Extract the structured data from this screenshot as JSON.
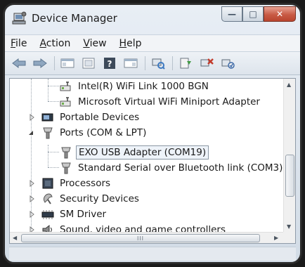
{
  "window": {
    "title": "Device Manager",
    "buttons": {
      "minimize": "—",
      "maximize": "□",
      "close": "✕"
    }
  },
  "menu": [
    {
      "underline": "F",
      "rest": "ile"
    },
    {
      "underline": "A",
      "rest": "ction"
    },
    {
      "underline": "V",
      "rest": "iew"
    },
    {
      "underline": "H",
      "rest": "elp"
    }
  ],
  "toolbar": {
    "icons": [
      "back-icon",
      "forward-icon",
      "console-tree-icon",
      "properties-icon",
      "help-icon",
      "action-pane-icon",
      "scan-hardware-icon",
      "update-driver-icon",
      "uninstall-icon",
      "disable-icon"
    ]
  },
  "tree": {
    "items": [
      {
        "label": "Intel(R) WiFi Link 1000 BGN",
        "level": 2,
        "icon": "network-adapter-icon"
      },
      {
        "label": "Microsoft Virtual WiFi Miniport Adapter",
        "level": 2,
        "icon": "network-adapter-icon"
      },
      {
        "label": "Portable Devices",
        "level": 1,
        "icon": "portable-device-icon",
        "expander": "collapsed"
      },
      {
        "label": "Ports (COM & LPT)",
        "level": 1,
        "icon": "port-icon",
        "expander": "expanded"
      },
      {
        "label": "EXO USB Adapter (COM19)",
        "level": 2,
        "icon": "port-icon",
        "selected": true
      },
      {
        "label": "Standard Serial over Bluetooth link (COM3)",
        "level": 2,
        "icon": "port-icon"
      },
      {
        "label": "Processors",
        "level": 1,
        "icon": "processor-icon",
        "expander": "collapsed"
      },
      {
        "label": "Security Devices",
        "level": 1,
        "icon": "security-device-icon",
        "expander": "collapsed"
      },
      {
        "label": "SM Driver",
        "level": 1,
        "icon": "sm-driver-icon",
        "expander": "collapsed"
      },
      {
        "label": "Sound, video and game controllers",
        "level": 1,
        "icon": "sound-icon",
        "expander": "collapsed"
      }
    ]
  },
  "scrollbar": {
    "h_thumb_grip": "III"
  }
}
